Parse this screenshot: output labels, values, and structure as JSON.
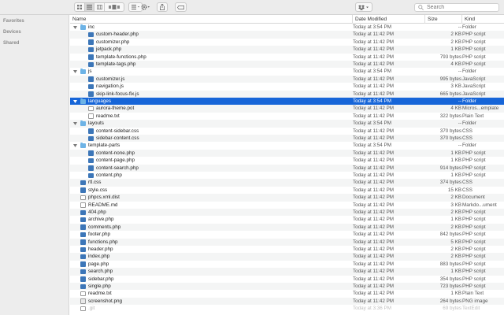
{
  "toolbar": {
    "view_cover_label": "",
    "search_placeholder": "Search"
  },
  "sidebar": {
    "sections": [
      "Favorites",
      "Devices",
      "Shared"
    ]
  },
  "columns": {
    "name": "Name",
    "date": "Date Modified",
    "size": "Size",
    "kind": "Kind"
  },
  "rows": [
    {
      "name": "inc",
      "date": "Today at 3:54 PM",
      "size": "--",
      "kind": "Folder",
      "icon": "folder",
      "depth": 0,
      "open": true
    },
    {
      "name": "custom-header.php",
      "date": "Today at 11:42 PM",
      "size": "2 KB",
      "kind": "PHP script",
      "icon": "php",
      "depth": 1
    },
    {
      "name": "customizer.php",
      "date": "Today at 11:42 PM",
      "size": "2 KB",
      "kind": "PHP script",
      "icon": "php",
      "depth": 1
    },
    {
      "name": "jetpack.php",
      "date": "Today at 11:42 PM",
      "size": "1 KB",
      "kind": "PHP script",
      "icon": "php",
      "depth": 1
    },
    {
      "name": "template-functions.php",
      "date": "Today at 11:42 PM",
      "size": "793 bytes",
      "kind": "PHP script",
      "icon": "php",
      "depth": 1
    },
    {
      "name": "template-tags.php",
      "date": "Today at 11:42 PM",
      "size": "4 KB",
      "kind": "PHP script",
      "icon": "php",
      "depth": 1
    },
    {
      "name": "js",
      "date": "Today at 3:54 PM",
      "size": "--",
      "kind": "Folder",
      "icon": "folder",
      "depth": 0,
      "open": true
    },
    {
      "name": "customizer.js",
      "date": "Today at 11:42 PM",
      "size": "995 bytes",
      "kind": "JavaScript",
      "icon": "js",
      "depth": 1
    },
    {
      "name": "navigation.js",
      "date": "Today at 11:42 PM",
      "size": "3 KB",
      "kind": "JavaScript",
      "icon": "js",
      "depth": 1
    },
    {
      "name": "skip-link-focus-fix.js",
      "date": "Today at 11:42 PM",
      "size": "665 bytes",
      "kind": "JavaScript",
      "icon": "js",
      "depth": 1
    },
    {
      "name": "languages",
      "date": "Today at 3:54 PM",
      "size": "--",
      "kind": "Folder",
      "icon": "folder",
      "depth": 0,
      "open": true,
      "selected": true
    },
    {
      "name": "aurora-theme.pot",
      "date": "Today at 11:42 PM",
      "size": "4 KB",
      "kind": "Micros...emplate",
      "icon": "doc",
      "depth": 1
    },
    {
      "name": "readme.txt",
      "date": "Today at 11:42 PM",
      "size": "322 bytes",
      "kind": "Plain Text",
      "icon": "doc",
      "depth": 1
    },
    {
      "name": "layouts",
      "date": "Today at 3:54 PM",
      "size": "--",
      "kind": "Folder",
      "icon": "folder",
      "depth": 0,
      "open": true
    },
    {
      "name": "content-sidebar.css",
      "date": "Today at 11:42 PM",
      "size": "370 bytes",
      "kind": "CSS",
      "icon": "css",
      "depth": 1
    },
    {
      "name": "sidebar-content.css",
      "date": "Today at 11:42 PM",
      "size": "370 bytes",
      "kind": "CSS",
      "icon": "css",
      "depth": 1
    },
    {
      "name": "template-parts",
      "date": "Today at 3:54 PM",
      "size": "--",
      "kind": "Folder",
      "icon": "folder",
      "depth": 0,
      "open": true
    },
    {
      "name": "content-none.php",
      "date": "Today at 11:42 PM",
      "size": "1 KB",
      "kind": "PHP script",
      "icon": "php",
      "depth": 1
    },
    {
      "name": "content-page.php",
      "date": "Today at 11:42 PM",
      "size": "1 KB",
      "kind": "PHP script",
      "icon": "php",
      "depth": 1
    },
    {
      "name": "content-search.php",
      "date": "Today at 11:42 PM",
      "size": "914 bytes",
      "kind": "PHP script",
      "icon": "php",
      "depth": 1
    },
    {
      "name": "content.php",
      "date": "Today at 11:42 PM",
      "size": "1 KB",
      "kind": "PHP script",
      "icon": "php",
      "depth": 1
    },
    {
      "name": "rtl.css",
      "date": "Today at 11:42 PM",
      "size": "374 bytes",
      "kind": "CSS",
      "icon": "css",
      "depth": 0
    },
    {
      "name": "style.css",
      "date": "Today at 11:42 PM",
      "size": "15 KB",
      "kind": "CSS",
      "icon": "css",
      "depth": 0
    },
    {
      "name": "phpcs.xml.dist",
      "date": "Today at 11:42 PM",
      "size": "2 KB",
      "kind": "Document",
      "icon": "doc",
      "depth": 0
    },
    {
      "name": "README.md",
      "date": "Today at 11:42 PM",
      "size": "3 KB",
      "kind": "Markdo...ument",
      "icon": "doc",
      "depth": 0
    },
    {
      "name": "404.php",
      "date": "Today at 11:42 PM",
      "size": "2 KB",
      "kind": "PHP script",
      "icon": "php",
      "depth": 0
    },
    {
      "name": "archive.php",
      "date": "Today at 11:42 PM",
      "size": "1 KB",
      "kind": "PHP script",
      "icon": "php",
      "depth": 0
    },
    {
      "name": "comments.php",
      "date": "Today at 11:42 PM",
      "size": "2 KB",
      "kind": "PHP script",
      "icon": "php",
      "depth": 0
    },
    {
      "name": "footer.php",
      "date": "Today at 11:42 PM",
      "size": "842 bytes",
      "kind": "PHP script",
      "icon": "php",
      "depth": 0
    },
    {
      "name": "functions.php",
      "date": "Today at 11:42 PM",
      "size": "5 KB",
      "kind": "PHP script",
      "icon": "php",
      "depth": 0
    },
    {
      "name": "header.php",
      "date": "Today at 11:42 PM",
      "size": "2 KB",
      "kind": "PHP script",
      "icon": "php",
      "depth": 0
    },
    {
      "name": "index.php",
      "date": "Today at 11:42 PM",
      "size": "2 KB",
      "kind": "PHP script",
      "icon": "php",
      "depth": 0
    },
    {
      "name": "page.php",
      "date": "Today at 11:42 PM",
      "size": "883 bytes",
      "kind": "PHP script",
      "icon": "php",
      "depth": 0
    },
    {
      "name": "search.php",
      "date": "Today at 11:42 PM",
      "size": "1 KB",
      "kind": "PHP script",
      "icon": "php",
      "depth": 0
    },
    {
      "name": "sidebar.php",
      "date": "Today at 11:42 PM",
      "size": "354 bytes",
      "kind": "PHP script",
      "icon": "php",
      "depth": 0
    },
    {
      "name": "single.php",
      "date": "Today at 11:42 PM",
      "size": "723 bytes",
      "kind": "PHP script",
      "icon": "php",
      "depth": 0
    },
    {
      "name": "readme.txt",
      "date": "Today at 11:42 PM",
      "size": "1 KB",
      "kind": "Plain Text",
      "icon": "doc",
      "depth": 0
    },
    {
      "name": "screenshot.png",
      "date": "Today at 11:42 PM",
      "size": "264 bytes",
      "kind": "PNG image",
      "icon": "img",
      "depth": 0
    },
    {
      "name": ".git",
      "date": "Today at 3:36 PM",
      "size": "69 bytes",
      "kind": "TextEdit",
      "icon": "doc",
      "depth": 0,
      "dim": true
    }
  ],
  "colors": {
    "selection": "#1665d8",
    "folder": "#6db3e6",
    "script_icon": "#3c76b8",
    "alt_row": "#f4f5f5"
  }
}
